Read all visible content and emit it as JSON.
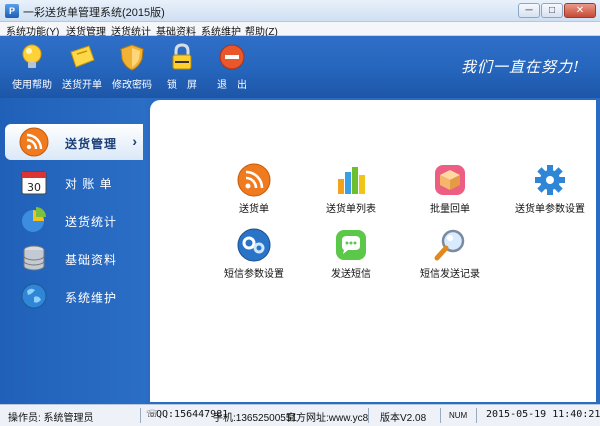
{
  "window": {
    "title": "一彩送货单管理系统(2015版)",
    "minimize": "─",
    "maximize": "□",
    "close": "✕"
  },
  "menu": [
    {
      "label": "系统功能(Y)"
    },
    {
      "label": "送货管理"
    },
    {
      "label": "送货统计"
    },
    {
      "label": "基础资料"
    },
    {
      "label": "系统维护"
    },
    {
      "label": "帮助(Z)"
    }
  ],
  "toolbar": {
    "items": [
      {
        "label": "使用帮助",
        "icon": "lightbulb-icon"
      },
      {
        "label": "送货开单",
        "icon": "ticket-icon"
      },
      {
        "label": "修改密码",
        "icon": "shield-icon"
      },
      {
        "label": "锁　屏",
        "icon": "lock-icon"
      },
      {
        "label": "退　出",
        "icon": "exit-icon"
      }
    ],
    "slogan": "我们一直在努力!"
  },
  "sidebar": {
    "items": [
      {
        "label": "送货管理",
        "icon": "rss-icon",
        "active": true
      },
      {
        "label": "对 账 单",
        "icon": "calendar-icon"
      },
      {
        "label": "送货统计",
        "icon": "pie-chart-icon"
      },
      {
        "label": "基础资料",
        "icon": "database-icon"
      },
      {
        "label": "系统维护",
        "icon": "globe-icon"
      }
    ],
    "active_chevron": "›"
  },
  "functions": [
    {
      "label": "送货单",
      "icon": "rss-icon"
    },
    {
      "label": "送货单列表",
      "icon": "bar-chart-icon"
    },
    {
      "label": "批量回单",
      "icon": "box-icon"
    },
    {
      "label": "送货单参数设置",
      "icon": "gear-icon"
    },
    {
      "label": "短信参数设置",
      "icon": "gears-icon"
    },
    {
      "label": "发送短信",
      "icon": "chat-icon"
    },
    {
      "label": "短信发送记录",
      "icon": "magnifier-icon"
    }
  ],
  "status": {
    "operator": "操作员: 系统管理员",
    "qq": "QQ:156447981",
    "phone": "手机:13652500551",
    "website": "官方网址:www.yc8",
    "version": "版本V2.08",
    "num": "NUM",
    "datetime": "2015-05-19 11:40:21"
  },
  "colors": {
    "toolbar_blue": "#2565bc",
    "sidebar_blue": "#2060b8",
    "accent_orange": "#f07b1e"
  }
}
